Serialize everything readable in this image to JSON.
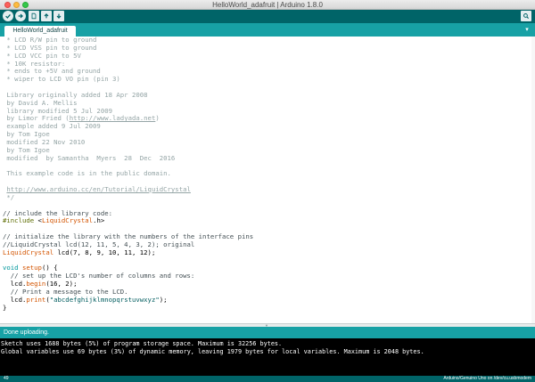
{
  "window": {
    "title": "HelloWorld_adafruit | Arduino 1.8.0"
  },
  "toolbar": {
    "verify_icon": "check-icon",
    "upload_icon": "arrow-right-icon",
    "new_icon": "new-file-icon",
    "open_icon": "arrow-up-icon",
    "save_icon": "arrow-down-icon",
    "serial_icon": "magnifier-icon",
    "accent": "#006468"
  },
  "tabs": [
    {
      "label": "HelloWorld_adafruit",
      "active": true
    }
  ],
  "editor": {
    "lines": [
      [
        {
          "t": " * LCD R/W pin to ground",
          "c": "comment"
        }
      ],
      [
        {
          "t": " * LCD VSS pin to ground",
          "c": "comment"
        }
      ],
      [
        {
          "t": " * LCD VCC pin to 5V",
          "c": "comment"
        }
      ],
      [
        {
          "t": " * 10K resistor:",
          "c": "comment"
        }
      ],
      [
        {
          "t": " * ends to +5V and ground",
          "c": "comment"
        }
      ],
      [
        {
          "t": " * wiper to LCD VO pin (pin 3)",
          "c": "comment"
        }
      ],
      [
        {
          "t": "",
          "c": "plain"
        }
      ],
      [
        {
          "t": " Library originally added 18 Apr 2008",
          "c": "comment"
        }
      ],
      [
        {
          "t": " by David A. Mellis",
          "c": "comment"
        }
      ],
      [
        {
          "t": " library modified 5 Jul 2009",
          "c": "comment"
        }
      ],
      [
        {
          "t": " by Limor Fried (",
          "c": "comment"
        },
        {
          "t": "http://www.ladyada.net",
          "c": "comment-u"
        },
        {
          "t": ")",
          "c": "comment"
        }
      ],
      [
        {
          "t": " example added 9 Jul 2009",
          "c": "comment"
        }
      ],
      [
        {
          "t": " by Tom Igoe",
          "c": "comment"
        }
      ],
      [
        {
          "t": " modified 22 Nov 2010",
          "c": "comment"
        }
      ],
      [
        {
          "t": " by Tom Igoe",
          "c": "comment"
        }
      ],
      [
        {
          "t": " modified  by Samantha  Myers  28  Dec  2016",
          "c": "comment"
        }
      ],
      [
        {
          "t": "",
          "c": "plain"
        }
      ],
      [
        {
          "t": " This example code is in the public domain.",
          "c": "comment"
        }
      ],
      [
        {
          "t": "",
          "c": "plain"
        }
      ],
      [
        {
          "t": " ",
          "c": "comment"
        },
        {
          "t": "http://www.arduino.cc/en/Tutorial/LiquidCrystal",
          "c": "comment-u"
        }
      ],
      [
        {
          "t": " */",
          "c": "comment"
        }
      ],
      [
        {
          "t": "",
          "c": "plain"
        }
      ],
      [
        {
          "t": "// include the library code:",
          "c": "line-comment"
        }
      ],
      [
        {
          "t": "#include ",
          "c": "pre"
        },
        {
          "t": "<",
          "c": "plain"
        },
        {
          "t": "LiquidCrystal",
          "c": "kw2"
        },
        {
          "t": ".h>",
          "c": "plain"
        }
      ],
      [
        {
          "t": "",
          "c": "plain"
        }
      ],
      [
        {
          "t": "// initialize the library with the numbers of the interface pins",
          "c": "line-comment"
        }
      ],
      [
        {
          "t": "//LiquidCrystal lcd(12, 11, 5, 4, 3, 2); original",
          "c": "line-comment"
        }
      ],
      [
        {
          "t": "LiquidCrystal",
          "c": "kw2"
        },
        {
          "t": " lcd(7, 8, 9, 10, 11, 12);",
          "c": "plain"
        }
      ],
      [
        {
          "t": "",
          "c": "plain"
        }
      ],
      [
        {
          "t": "void",
          "c": "kw"
        },
        {
          "t": " ",
          "c": "plain"
        },
        {
          "t": "setup",
          "c": "kw2"
        },
        {
          "t": "() {",
          "c": "plain"
        }
      ],
      [
        {
          "t": "  // set up the LCD's number of columns and rows:",
          "c": "line-comment"
        }
      ],
      [
        {
          "t": "  lcd.",
          "c": "plain"
        },
        {
          "t": "begin",
          "c": "kw2"
        },
        {
          "t": "(16, 2);",
          "c": "plain"
        }
      ],
      [
        {
          "t": "  // Print a message to the LCD.",
          "c": "line-comment"
        }
      ],
      [
        {
          "t": "  lcd.",
          "c": "plain"
        },
        {
          "t": "print",
          "c": "kw2"
        },
        {
          "t": "(",
          "c": "plain"
        },
        {
          "t": "\"abcdefghijklmnopqrstuvwxyz\"",
          "c": "str"
        },
        {
          "t": ");",
          "c": "plain"
        }
      ],
      [
        {
          "t": "}",
          "c": "plain"
        }
      ]
    ]
  },
  "status": {
    "message": "Done uploading."
  },
  "console": {
    "lines": [
      "Sketch uses 1688 bytes (5%) of program storage space. Maximum is 32256 bytes.",
      "Global variables use 69 bytes (3%) of dynamic memory, leaving 1979 bytes for local variables. Maximum is 2048 bytes."
    ]
  },
  "footer": {
    "line_number": "49",
    "board_info": "Arduino/Genuino Uno on /dev/cu.usbmodem"
  }
}
